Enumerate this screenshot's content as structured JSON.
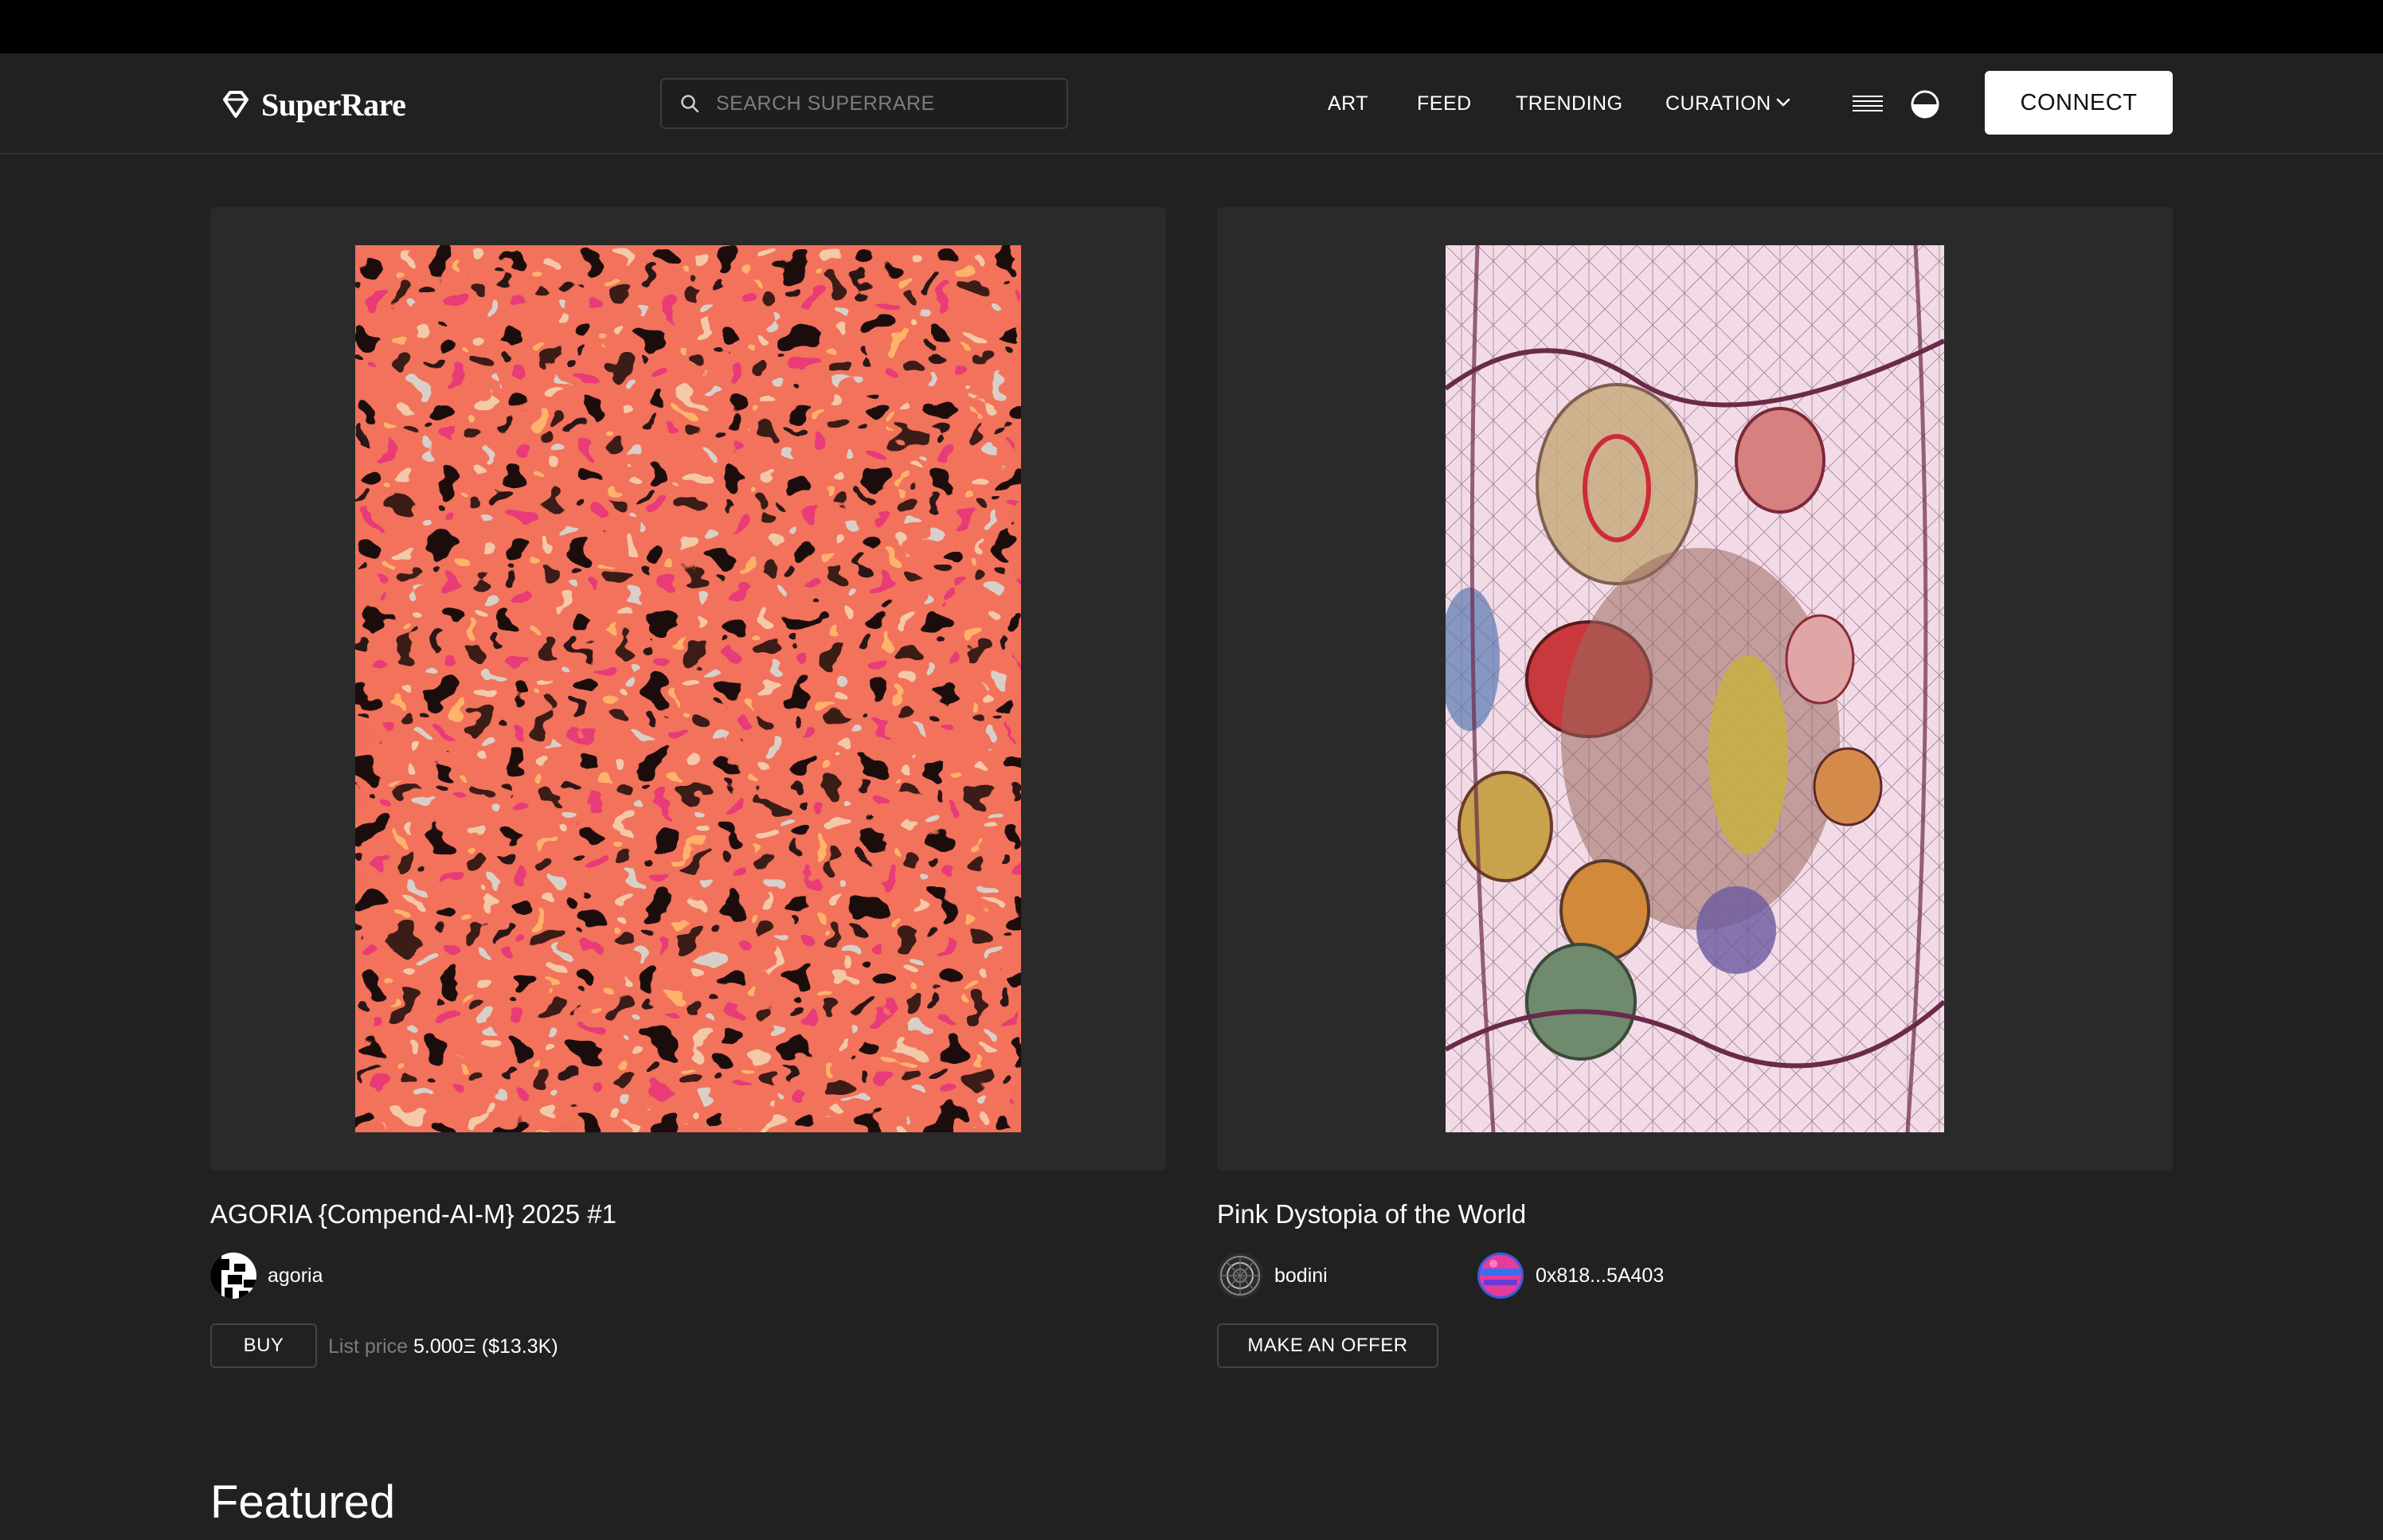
{
  "colors": {
    "background": "#212121",
    "top_strip": "#000000",
    "card": "#2a2a2a",
    "border": "#444444",
    "muted_text": "#7d7d7d"
  },
  "header": {
    "logo_text": "SuperRare",
    "logo_icon": "diamond-icon",
    "search": {
      "placeholder": "SEARCH SUPERRARE",
      "icon": "search-icon"
    },
    "nav": [
      {
        "label": "ART"
      },
      {
        "label": "FEED"
      },
      {
        "label": "TRENDING"
      },
      {
        "label": "CURATION",
        "icon": "chevron-down-icon"
      }
    ],
    "menu_icon": "hamburger-menu-icon",
    "theme_icon": "theme-toggle-icon",
    "connect_label": "CONNECT"
  },
  "artworks": [
    {
      "title": "AGORIA {Compend-AI-M} 2025 #1",
      "artist": "agoria",
      "action_label": "BUY",
      "price_label": "List price",
      "price_value": "5.000Ξ ($13.3K)"
    },
    {
      "title": "Pink Dystopia of the World",
      "artist": "bodini",
      "owner": "0x818...5A403",
      "action_label": "MAKE AN OFFER"
    }
  ],
  "featured_heading": "Featured"
}
